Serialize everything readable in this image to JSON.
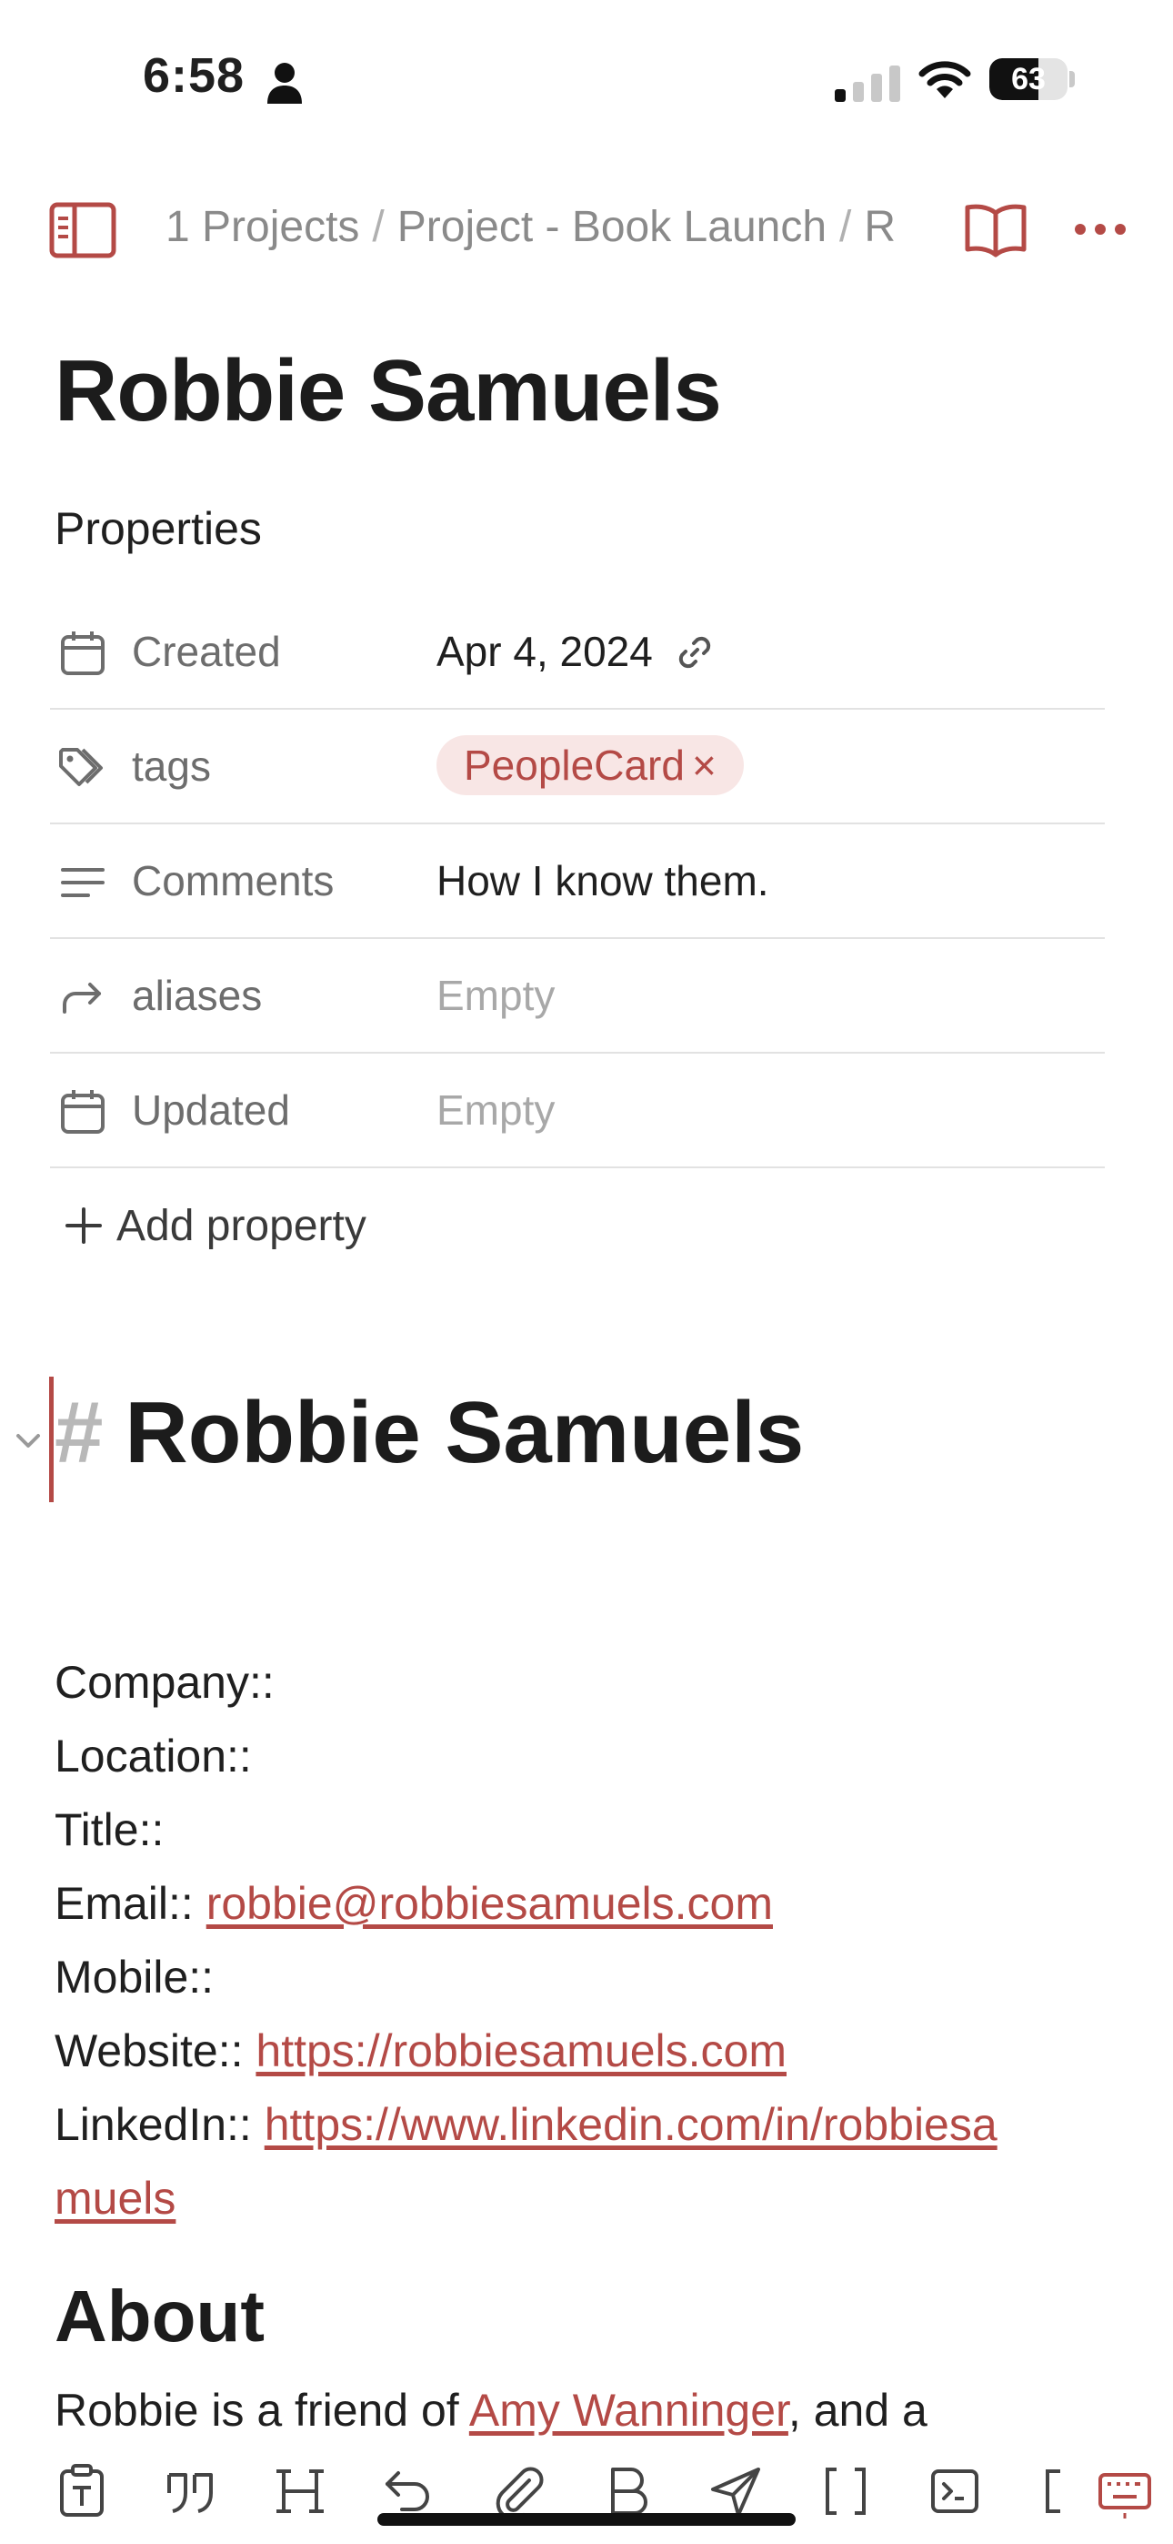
{
  "status_bar": {
    "time": "6:58",
    "battery": "63",
    "battery_level": 0.63
  },
  "nav": {
    "breadcrumb": [
      "1 Projects",
      "Project - Book Launch",
      "R"
    ],
    "separator": "/"
  },
  "page": {
    "title": "Robbie Samuels"
  },
  "properties": {
    "heading": "Properties",
    "rows": [
      {
        "icon": "calendar-icon",
        "label": "Created",
        "value": "Apr 4, 2024"
      },
      {
        "icon": "tags-icon",
        "label": "tags",
        "value": "PeopleCard"
      },
      {
        "icon": "lines-icon",
        "label": "Comments",
        "value": "How I know them."
      },
      {
        "icon": "redirect-arrow-icon",
        "label": "aliases",
        "value": "Empty"
      },
      {
        "icon": "calendar-icon",
        "label": "Updated",
        "value": "Empty"
      }
    ],
    "add_label": "Add property"
  },
  "content": {
    "heading_hash": "#",
    "heading": "Robbie Samuels",
    "fields": [
      {
        "label": "Company::",
        "value": ""
      },
      {
        "label": "Location::",
        "value": ""
      },
      {
        "label": "Title::",
        "value": ""
      },
      {
        "label": "Email::",
        "value": "robbie@robbiesamuels.com"
      },
      {
        "label": "Mobile::",
        "value": ""
      },
      {
        "label": "Website::",
        "value": "https://robbiesamuels.com"
      },
      {
        "label": "LinkedIn::",
        "value": "https://www.linkedin.com/in/robbiesa",
        "value_cont": "muels"
      }
    ],
    "about_heading": "About",
    "about_prefix": "Robbie is a friend of ",
    "about_link": "Amy Wanninger",
    "about_suffix": ", and a"
  },
  "toolbar": {
    "icons": [
      "text-format-icon",
      "quote-icon",
      "heading-icon",
      "undo-icon",
      "attachment-icon",
      "bold-icon",
      "send-icon",
      "brackets-icon",
      "terminal-icon",
      "bracket-icon",
      "keyboard-icon"
    ]
  },
  "colors": {
    "accent": "#b44a46",
    "muted": "#6d6d6d",
    "placeholder": "#a8a8a8",
    "tag_bg": "#f8e6e5"
  }
}
